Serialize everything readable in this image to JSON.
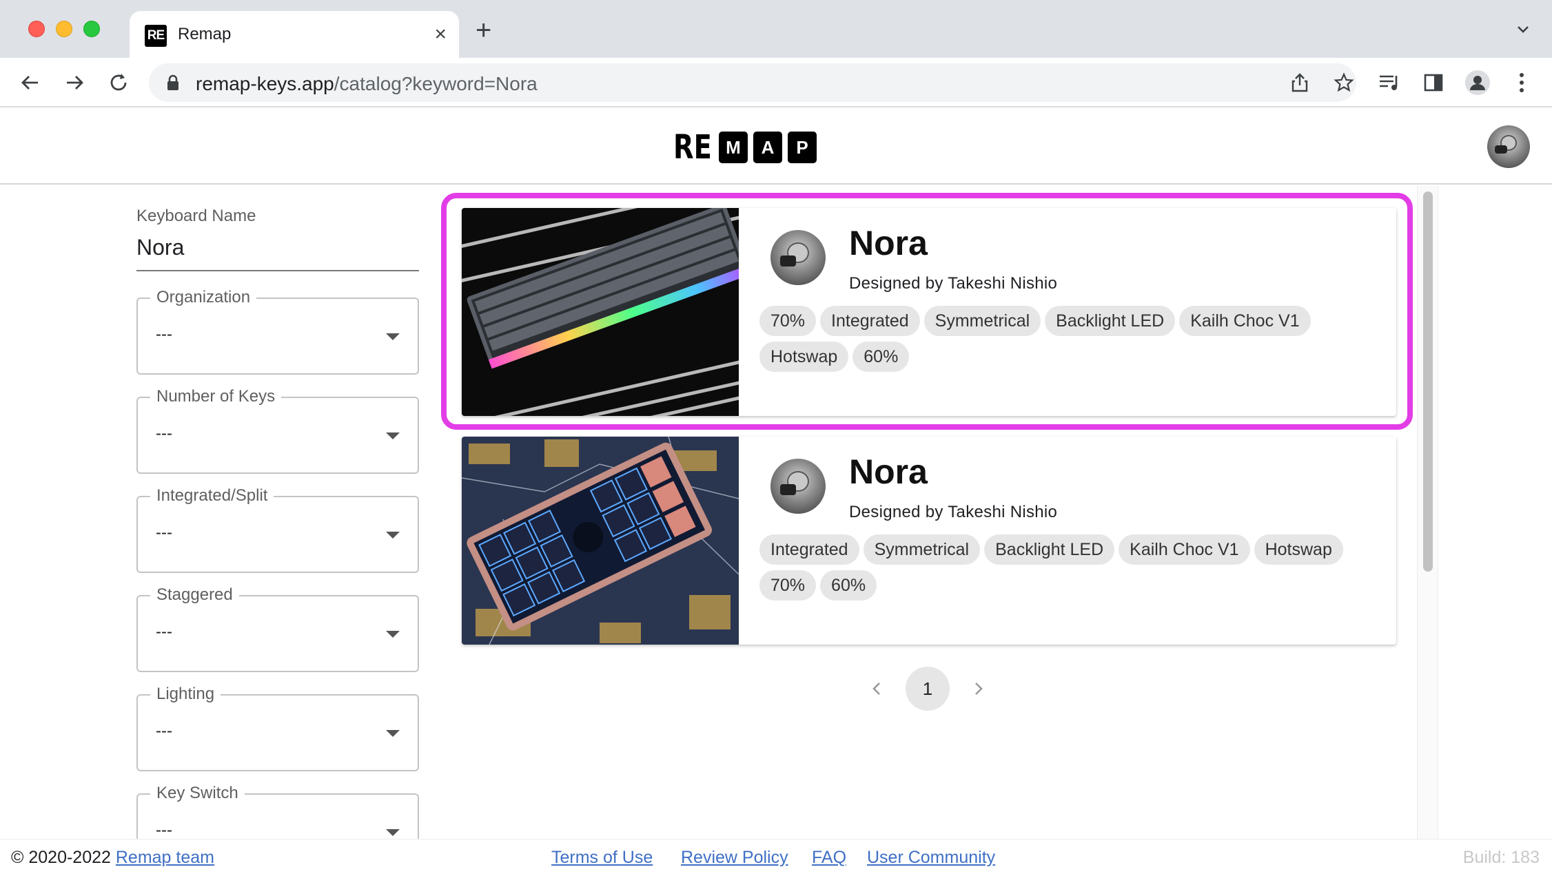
{
  "browser": {
    "tab_title": "Remap",
    "favicon_text": "RE",
    "url_host": "remap-keys.app",
    "url_path": "/catalog?keyword=Nora"
  },
  "app": {
    "logo_prefix": "RE",
    "logo_letters": [
      "M",
      "A",
      "P"
    ]
  },
  "sidebar": {
    "keyboard_name_label": "Keyboard Name",
    "keyboard_name_value": "Nora",
    "filters": [
      {
        "label": "Organization",
        "value": "---"
      },
      {
        "label": "Number of Keys",
        "value": "---"
      },
      {
        "label": "Integrated/Split",
        "value": "---"
      },
      {
        "label": "Staggered",
        "value": "---"
      },
      {
        "label": "Lighting",
        "value": "---"
      },
      {
        "label": "Key Switch",
        "value": "---"
      }
    ]
  },
  "results": [
    {
      "name": "Nora",
      "designer": "Designed by Takeshi Nishio",
      "tags": [
        "70%",
        "Integrated",
        "Symmetrical",
        "Backlight LED",
        "Kailh Choc V1",
        "Hotswap",
        "60%"
      ],
      "highlighted": true
    },
    {
      "name": "Nora",
      "designer": "Designed by Takeshi Nishio",
      "tags": [
        "Integrated",
        "Symmetrical",
        "Backlight LED",
        "Kailh Choc V1",
        "Hotswap",
        "70%",
        "60%"
      ],
      "highlighted": false
    }
  ],
  "pagination": {
    "current_page": "1"
  },
  "footer": {
    "copyright": "© 2020-2022 ",
    "team_link": "Remap team",
    "links": [
      "Terms of Use",
      "Review Policy",
      "FAQ",
      "User Community"
    ],
    "build": "Build: 183"
  },
  "colors": {
    "highlight": "#e23de6",
    "link": "#3f6fc5",
    "chip_bg": "#e6e6e6"
  },
  "icons": {
    "back": "arrow-left-icon",
    "forward": "arrow-right-icon",
    "reload": "reload-icon",
    "lock": "lock-icon",
    "share": "share-icon",
    "bookmark": "star-icon",
    "media": "media-queue-icon",
    "sidepanel": "side-panel-icon",
    "profile": "profile-icon",
    "menu": "kebab-menu-icon"
  }
}
